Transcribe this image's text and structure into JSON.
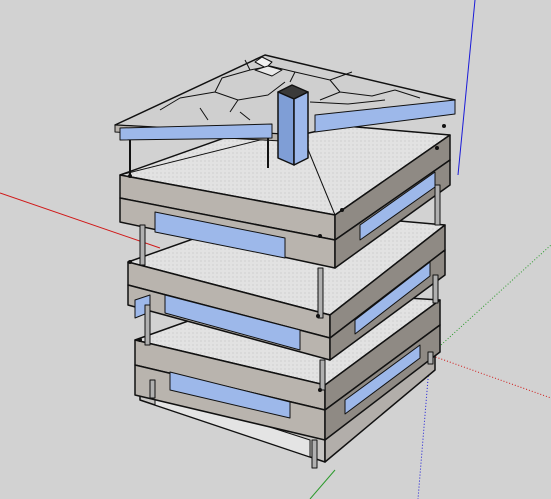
{
  "app": {
    "view": "3d-model-viewport"
  },
  "colors": {
    "background": "#d2d2d2",
    "axis_red": "#d01818",
    "axis_green": "#2c9a2c",
    "axis_blue": "#1a1ad8",
    "glass": "#9db8ea",
    "glass_dark": "#7f9ed6",
    "slab_top": "#dcdcdc",
    "slab_face": "#b9b4ae",
    "slab_face_dark": "#8f8a84",
    "outline": "#111111",
    "roof_tile": "#cfcfcf"
  },
  "model": {
    "floors": 4,
    "columns_visible": true,
    "roof_pattern": "voronoi-tiles"
  }
}
